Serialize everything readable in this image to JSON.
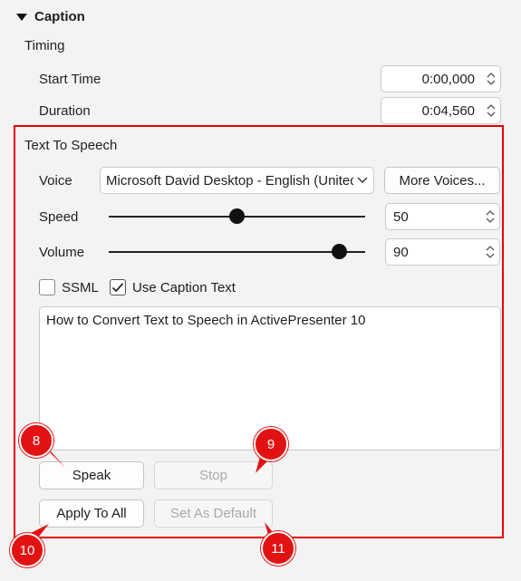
{
  "caption": {
    "header": "Caption",
    "timing_label": "Timing",
    "start_time": {
      "label": "Start Time",
      "value": "0:00,000"
    },
    "duration": {
      "label": "Duration",
      "value": "0:04,560"
    }
  },
  "tts": {
    "section_label": "Text To Speech",
    "voice": {
      "label": "Voice",
      "value": "Microsoft David Desktop - English (United States)"
    },
    "more_voices_label": "More Voices...",
    "speed": {
      "label": "Speed",
      "value": "50",
      "level": 0.5
    },
    "volume": {
      "label": "Volume",
      "value": "90",
      "level": 0.9
    },
    "ssml": {
      "label": "SSML",
      "checked": false
    },
    "use_caption_text": {
      "label": "Use Caption Text",
      "checked": true
    },
    "text": "How to Convert Text to Speech in ActivePresenter 10",
    "buttons": {
      "speak": "Speak",
      "stop": "Stop",
      "apply_to_all": "Apply To All",
      "set_as_default": "Set As Default"
    }
  },
  "callouts": {
    "badge_8": "8",
    "badge_9": "9",
    "badge_10": "10",
    "badge_11": "11",
    "color": "#e31212"
  },
  "colors": {
    "highlight_border": "#e60000",
    "background": "#f3f3f3"
  },
  "icons": [
    "collapse-caret-icon",
    "spin-up-icon",
    "spin-down-icon",
    "dropdown-chevron-icon",
    "checkmark-icon"
  ]
}
